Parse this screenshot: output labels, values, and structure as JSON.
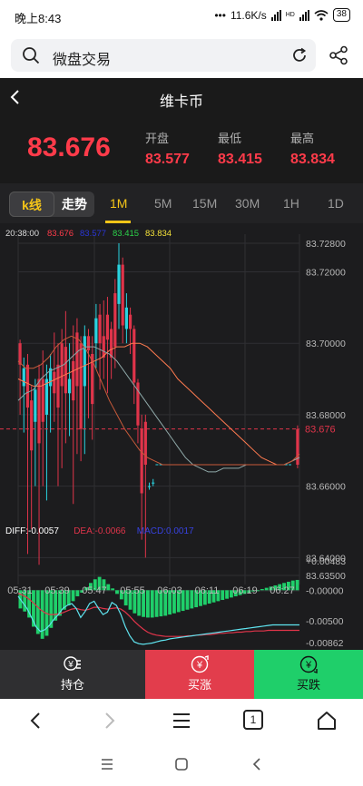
{
  "status_bar": {
    "time": "晚上8:43",
    "dots": "•••",
    "network_speed": "11.6K/s",
    "signal_label": "HD",
    "battery": "38"
  },
  "browser": {
    "search_text": "微盘交易"
  },
  "nav": {
    "title": "维卡币"
  },
  "quote": {
    "price": "83.676",
    "open_label": "开盘",
    "open": "83.577",
    "low_label": "最低",
    "low": "83.415",
    "high_label": "最高",
    "high": "83.834"
  },
  "tabs": {
    "kline": "k线",
    "trend": "走势",
    "periods": [
      "1M",
      "5M",
      "15M",
      "30M",
      "1H",
      "1D"
    ],
    "active_period": "1M"
  },
  "chart_data": [
    {
      "type": "candlestick",
      "info_line": {
        "time": "20:38:00",
        "values": [
          "83.676",
          "83.577",
          "83.415",
          "83.834"
        ],
        "colors": [
          "#ff3b4a",
          "#2a36d8",
          "#2bd24a",
          "#f5e23a"
        ]
      },
      "y_ticks": [
        "83.72800",
        "83.72000",
        "83.70000",
        "83.68000",
        "83.66000",
        "83.64000",
        "83.63500"
      ],
      "ylim": [
        83.635,
        83.728
      ],
      "x_ticks": [
        "05:31",
        "05:39",
        "05:47",
        "05:55",
        "06:03",
        "06:11",
        "06:19",
        "06:27"
      ],
      "current_price_label": "83.676",
      "current_price": 83.676,
      "candles": [
        {
          "o": 83.7,
          "c": 83.694,
          "h": 83.701,
          "l": 83.68
        },
        {
          "o": 83.688,
          "c": 83.693,
          "h": 83.696,
          "l": 83.675
        },
        {
          "o": 83.694,
          "c": 83.682,
          "h": 83.697,
          "l": 83.641
        },
        {
          "o": 83.684,
          "c": 83.67,
          "h": 83.688,
          "l": 83.648
        },
        {
          "o": 83.678,
          "c": 83.687,
          "h": 83.69,
          "l": 83.66
        },
        {
          "o": 83.69,
          "c": 83.672,
          "h": 83.694,
          "l": 83.638
        },
        {
          "o": 83.69,
          "c": 83.678,
          "h": 83.698,
          "l": 83.66
        },
        {
          "o": 83.68,
          "c": 83.69,
          "h": 83.694,
          "l": 83.656
        },
        {
          "o": 83.688,
          "c": 83.693,
          "h": 83.697,
          "l": 83.675
        },
        {
          "o": 83.692,
          "c": 83.686,
          "h": 83.703,
          "l": 83.678
        },
        {
          "o": 83.694,
          "c": 83.682,
          "h": 83.7,
          "l": 83.66
        },
        {
          "o": 83.7,
          "c": 83.688,
          "h": 83.704,
          "l": 83.665
        },
        {
          "o": 83.699,
          "c": 83.686,
          "h": 83.709,
          "l": 83.672
        },
        {
          "o": 83.686,
          "c": 83.69,
          "h": 83.7,
          "l": 83.674
        },
        {
          "o": 83.695,
          "c": 83.684,
          "h": 83.705,
          "l": 83.655
        },
        {
          "o": 83.703,
          "c": 83.688,
          "h": 83.707,
          "l": 83.669
        },
        {
          "o": 83.7,
          "c": 83.676,
          "h": 83.702,
          "l": 83.667
        },
        {
          "o": 83.688,
          "c": 83.702,
          "h": 83.705,
          "l": 83.669
        },
        {
          "o": 83.702,
          "c": 83.698,
          "h": 83.704,
          "l": 83.679
        },
        {
          "o": 83.697,
          "c": 83.683,
          "h": 83.702,
          "l": 83.673
        },
        {
          "o": 83.7,
          "c": 83.707,
          "h": 83.711,
          "l": 83.693
        },
        {
          "o": 83.708,
          "c": 83.7,
          "h": 83.711,
          "l": 83.687
        },
        {
          "o": 83.702,
          "c": 83.696,
          "h": 83.712,
          "l": 83.69
        },
        {
          "o": 83.708,
          "c": 83.701,
          "h": 83.713,
          "l": 83.686
        },
        {
          "o": 83.704,
          "c": 83.696,
          "h": 83.706,
          "l": 83.69
        },
        {
          "o": 83.714,
          "c": 83.699,
          "h": 83.718,
          "l": 83.693
        },
        {
          "o": 83.711,
          "c": 83.722,
          "h": 83.728,
          "l": 83.704
        },
        {
          "o": 83.722,
          "c": 83.705,
          "h": 83.724,
          "l": 83.7
        },
        {
          "o": 83.704,
          "c": 83.71,
          "h": 83.714,
          "l": 83.7
        },
        {
          "o": 83.708,
          "c": 83.704,
          "h": 83.71,
          "l": 83.697
        },
        {
          "o": 83.704,
          "c": 83.689,
          "h": 83.705,
          "l": 83.683
        },
        {
          "o": 83.689,
          "c": 83.677,
          "h": 83.69,
          "l": 83.672
        },
        {
          "o": 83.676,
          "c": 83.658,
          "h": 83.68,
          "l": 83.645
        },
        {
          "o": 83.678,
          "c": 83.666,
          "h": 83.68,
          "l": 83.64
        },
        {
          "o": 83.66,
          "c": 83.66,
          "h": 83.661,
          "l": 83.659
        },
        {
          "o": 83.661,
          "c": 83.661,
          "h": 83.662,
          "l": 83.66
        }
      ],
      "flat_segment": {
        "price": 83.666,
        "from_index": 36,
        "to_index": 72
      },
      "last_candle": {
        "o": 83.666,
        "c": 83.676,
        "h": 83.677,
        "l": 83.665
      },
      "ma_lines": [
        {
          "color": "#ff7b50",
          "values": [
            83.69,
            83.689,
            83.688,
            83.688,
            83.689,
            83.69,
            83.691,
            83.692,
            83.693,
            83.694,
            83.695,
            83.696,
            83.698,
            83.699,
            83.699,
            83.7,
            83.7,
            83.699,
            83.697,
            83.695,
            83.693,
            83.69,
            83.688,
            83.686,
            83.684,
            83.682,
            83.68,
            83.678,
            83.676,
            83.674,
            83.672,
            83.67,
            83.668,
            83.667,
            83.666,
            83.666,
            83.667,
            83.668
          ]
        },
        {
          "color": "#8fa8a8",
          "values": [
            83.684,
            83.686,
            83.687,
            83.69,
            83.692,
            83.693,
            83.694,
            83.696,
            83.698,
            83.699,
            83.699,
            83.698,
            83.697,
            83.695,
            83.692,
            83.689,
            83.686,
            83.683,
            83.68,
            83.677,
            83.674,
            83.671,
            83.668,
            83.666,
            83.665,
            83.664,
            83.664,
            83.665,
            83.665,
            83.665,
            83.666,
            83.666,
            83.666,
            83.666,
            83.666,
            83.666,
            83.667,
            83.668
          ]
        },
        {
          "color": "#c75a3a",
          "values": [
            83.695,
            83.693,
            83.693,
            83.694,
            83.696,
            83.699,
            83.701,
            83.702,
            83.701,
            83.698,
            83.694,
            83.689,
            83.684,
            83.68,
            83.676,
            83.673,
            83.67,
            83.668,
            83.667,
            83.666,
            83.666,
            83.666,
            83.666,
            83.666,
            83.666,
            83.666,
            83.666,
            83.666,
            83.666,
            83.666,
            83.666,
            83.666,
            83.666,
            83.666,
            83.666,
            83.666,
            83.667,
            83.669
          ]
        }
      ]
    },
    {
      "type": "macd",
      "legend": {
        "diff_label": "DIFF:",
        "diff": "-0.0057",
        "dea_label": "DEA:",
        "dea": "-0.0066",
        "macd_label": "MACD:",
        "macd": "0.0017"
      },
      "y_ticks": [
        "+0.00483",
        "-0.00000",
        "-0.00500",
        "-0.00862"
      ],
      "ylim": [
        -0.00862,
        0.00483
      ],
      "histogram": [
        -0.003,
        -0.0035,
        -0.0045,
        -0.006,
        -0.0072,
        -0.008,
        -0.0075,
        -0.0062,
        -0.005,
        -0.0042,
        -0.0032,
        -0.0025,
        -0.0018,
        -0.001,
        -0.0004,
        0.0005,
        0.0012,
        0.0018,
        0.0022,
        0.0018,
        0.001,
        0.0003,
        -0.0006,
        -0.0015,
        -0.0025,
        -0.0032,
        -0.0038,
        -0.0042,
        -0.0044,
        -0.0045,
        -0.0045,
        -0.0044,
        -0.0043,
        -0.0042,
        -0.004,
        -0.0038,
        -0.0036,
        -0.0034,
        -0.0032,
        -0.003,
        -0.0028,
        -0.0026,
        -0.0024,
        -0.0022,
        -0.002,
        -0.0018,
        -0.0016,
        -0.0014,
        -0.0012,
        -0.001,
        -0.0008,
        -0.0006,
        -0.0004,
        -0.0002,
        0.0,
        0.0002,
        0.0004,
        0.0006,
        0.0008,
        0.001,
        0.0012,
        0.0014,
        0.0016,
        0.0017
      ],
      "diff_line": [
        -0.001,
        -0.002,
        -0.003,
        -0.0045,
        -0.006,
        -0.0068,
        -0.0065,
        -0.0058,
        -0.0048,
        -0.004,
        -0.003,
        -0.0025,
        -0.0022,
        -0.003,
        -0.0045,
        -0.0035,
        -0.0022,
        -0.0018,
        -0.003,
        -0.004,
        -0.0036,
        -0.002,
        -0.0025,
        -0.004,
        -0.006,
        -0.0075,
        -0.0085,
        -0.0088,
        -0.0089,
        -0.0088,
        -0.0087,
        -0.0085,
        -0.0083,
        -0.0082,
        -0.008,
        -0.0079,
        -0.0078,
        -0.0077,
        -0.0076,
        -0.0075,
        -0.0074,
        -0.0073,
        -0.0072,
        -0.0071,
        -0.007,
        -0.0069,
        -0.0068,
        -0.0067,
        -0.0066,
        -0.0065,
        -0.0064,
        -0.0063,
        -0.0062,
        -0.0061,
        -0.006,
        -0.0059,
        -0.0058,
        -0.0057,
        -0.0057,
        -0.0057,
        -0.0057,
        -0.0057,
        -0.0057,
        -0.0057
      ],
      "dea_line": [
        -0.0005,
        -0.0008,
        -0.0012,
        -0.0018,
        -0.0025,
        -0.0032,
        -0.0037,
        -0.004,
        -0.004,
        -0.0039,
        -0.0037,
        -0.0034,
        -0.0031,
        -0.003,
        -0.0032,
        -0.0033,
        -0.0031,
        -0.0028,
        -0.0028,
        -0.003,
        -0.0031,
        -0.003,
        -0.0029,
        -0.0031,
        -0.0036,
        -0.0043,
        -0.0051,
        -0.0058,
        -0.0064,
        -0.0069,
        -0.0072,
        -0.0074,
        -0.0075,
        -0.0076,
        -0.0076,
        -0.0076,
        -0.0076,
        -0.0076,
        -0.0075,
        -0.0075,
        -0.0074,
        -0.0074,
        -0.0073,
        -0.0073,
        -0.0072,
        -0.0071,
        -0.0071,
        -0.007,
        -0.007,
        -0.0069,
        -0.0069,
        -0.0068,
        -0.0068,
        -0.0067,
        -0.0067,
        -0.0067,
        -0.0066,
        -0.0066,
        -0.0066,
        -0.0066,
        -0.0066,
        -0.0066,
        -0.0066,
        -0.0066
      ]
    }
  ],
  "actions": {
    "hold": "持仓",
    "buy_up": "买涨",
    "buy_down": "买跌"
  },
  "browser_bar": {
    "tab_count": "1"
  },
  "colors": {
    "up": "#e0344a",
    "down": "#29d3e0",
    "accent": "#f5c518",
    "price_red": "#ff3b4a",
    "buy_up": "#e23d4c",
    "buy_down": "#1fcf6a"
  }
}
